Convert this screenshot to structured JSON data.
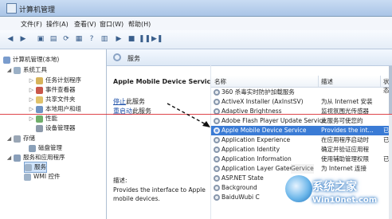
{
  "window": {
    "title": "计算机管理"
  },
  "menu": [
    "文件(F)",
    "操作(A)",
    "查看(V)",
    "窗口(W)",
    "帮助(H)"
  ],
  "tree": {
    "root": "计算机管理(本地)",
    "system_tools": "系统工具",
    "items": [
      "任务计划程序",
      "事件查看器",
      "共享文件夹",
      "本地用户和组",
      "性能",
      "设备管理器"
    ],
    "storage": "存储",
    "disk_mgmt": "磁盘管理",
    "services_apps": "服务和应用程序",
    "services": "服务",
    "wmi": "WMI 控件"
  },
  "services_panel": {
    "header": "服务",
    "selected_name": "Apple Mobile Device Service",
    "stop_link": "停止",
    "stop_suffix": "此服务",
    "restart_link": "重启动",
    "restart_suffix": "此服务",
    "desc_label": "描述:",
    "desc_text": "Provides the interface to Apple mobile devices.",
    "columns": {
      "name": "名称",
      "desc": "描述",
      "status": "状态"
    },
    "rows": [
      {
        "name": "360 杀毒实时防护加载服务",
        "desc": "",
        "status": ""
      },
      {
        "name": "ActiveX Installer (AxInstSV)",
        "desc": "为从 Internet 安装",
        "status": ""
      },
      {
        "name": "Adaptive Brightness",
        "desc": "监视氛围光传感器",
        "status": ""
      },
      {
        "name": "Adobe Flash Player Update Service",
        "desc": "此服务可使您的",
        "status": ""
      },
      {
        "name": "Apple Mobile Device Service",
        "desc": "Provides the int...",
        "status": "已启"
      },
      {
        "name": "Application Experience",
        "desc": "在应用程序启动时",
        "status": "已启"
      },
      {
        "name": "Application Identity",
        "desc": "确定并验证应用程",
        "status": ""
      },
      {
        "name": "Application Information",
        "desc": "使用辅助管理权限",
        "status": "已启"
      },
      {
        "name": "Application Layer Gatew",
        "desc": "为 Internet 连接",
        "status": ""
      },
      {
        "name": "ASP.NET State",
        "desc": "",
        "status": ""
      },
      {
        "name": "Background",
        "desc": "",
        "status": ""
      },
      {
        "name": "BaiduWubi C",
        "desc": "",
        "status": ""
      }
    ],
    "overlay_label": "Gervice"
  },
  "watermark": {
    "line1": "系统之家",
    "line2": "Win10net.com"
  }
}
